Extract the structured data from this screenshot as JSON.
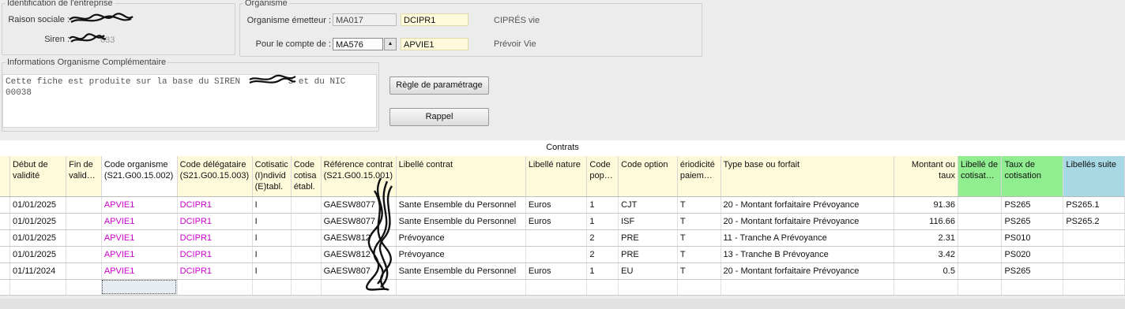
{
  "identification": {
    "legend": "Identification de l'entreprise",
    "raison_label": "Raison sociale :",
    "siren_label": "Siren :",
    "siren_visible_tail": "633"
  },
  "organisme": {
    "legend": "Organisme",
    "emetteur_label": "Organisme émetteur :",
    "emetteur_code": "MA017",
    "emetteur_ref": "DCIPR1",
    "emetteur_name": "CIPRÉS vie",
    "compte_label": "Pour le compte de :",
    "compte_code": "MA576",
    "compte_ref": "APVIE1",
    "compte_name": "Prévoir Vie"
  },
  "info": {
    "legend": "Informations Organisme Complémentaire",
    "text_line1_start": "Cette fiche est produite sur la base du SIREN ",
    "text_line1_end": "3 et du NIC",
    "text_line2": "00038"
  },
  "buttons": {
    "regle": "Règle de paramétrage",
    "rappel": "Rappel"
  },
  "grid": {
    "title": "Contrats",
    "columns": [
      "",
      "Début de validité",
      "Fin de valid…",
      "Code organisme (S21.G00.15.002)",
      "Code délégataire (S21.G00.15.003)",
      "Cotisatic (I)ndivid (E)tabl.",
      "Code cotisa établ.",
      "Référence contrat (S21.G00.15.001)",
      "Libellé contrat",
      "Libellé nature",
      "Code pop…",
      "Code option",
      "ériodicité paiem…",
      "Type base ou forfait",
      "Montant ou taux",
      "Libellé de cotisat…",
      "Taux de cotisation",
      "Libellés suite"
    ],
    "rows": [
      [
        "",
        "01/01/2025",
        "",
        "APVIE1",
        "DCIPR1",
        "I",
        "",
        "GAESW8077",
        "Sante Ensemble du Personnel",
        "Euros",
        "1",
        "CJT",
        "T",
        "20 - Montant forfaitaire Prévoyance",
        "91.36",
        "",
        "PS265",
        "PS265.1"
      ],
      [
        "",
        "01/01/2025",
        "",
        "APVIE1",
        "DCIPR1",
        "I",
        "",
        "GAESW8077",
        "Sante Ensemble du Personnel",
        "Euros",
        "1",
        "ISF",
        "T",
        "20 - Montant forfaitaire Prévoyance",
        "116.66",
        "",
        "PS265",
        "PS265.2"
      ],
      [
        "",
        "01/01/2025",
        "",
        "APVIE1",
        "DCIPR1",
        "I",
        "",
        "GAESW812",
        "Prévoyance",
        "",
        "2",
        "PRE",
        "T",
        "11 - Tranche A Prévoyance",
        "2.31",
        "",
        "PS010",
        ""
      ],
      [
        "",
        "01/01/2025",
        "",
        "APVIE1",
        "DCIPR1",
        "I",
        "",
        "GAESW812",
        "Prévoyance",
        "",
        "2",
        "PRE",
        "T",
        "13 - Tranche B Prévoyance",
        "3.42",
        "",
        "PS020",
        ""
      ],
      [
        "",
        "01/11/2024",
        "",
        "APVIE1",
        "DCIPR1",
        "I",
        "",
        "GAESW807",
        "Sante Ensemble du Personnel",
        "Euros",
        "1",
        "EU",
        "T",
        "20 - Montant forfaitaire Prévoyance",
        "0.5",
        "",
        "PS265",
        ""
      ]
    ]
  }
}
